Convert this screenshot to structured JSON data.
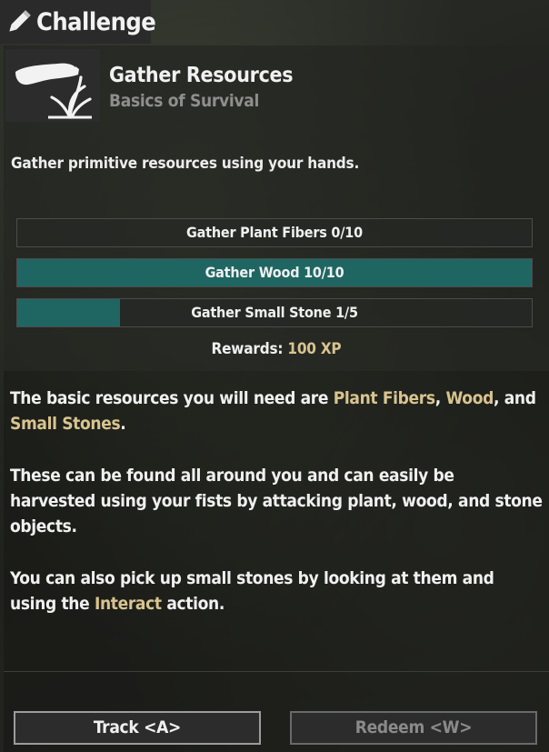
{
  "header": {
    "title": "Challenge",
    "icon": "pencil-icon"
  },
  "quest": {
    "icon": "gather-hand-icon",
    "title": "Gather Resources",
    "subtitle": "Basics of Survival",
    "description": "Gather primitive resources using your hands."
  },
  "objectives": [
    {
      "label": "Gather Plant Fibers 0/10",
      "progress": 0.0
    },
    {
      "label": "Gather Wood 10/10",
      "progress": 1.0
    },
    {
      "label": "Gather Small Stone 1/5",
      "progress": 0.2
    }
  ],
  "rewards": {
    "label": "Rewards:",
    "value": "100 XP"
  },
  "body": {
    "p1": {
      "t1": "The basic resources you will need are ",
      "h1": "Plant Fibers",
      "t2": ", ",
      "h2": "Wood",
      "t3": ", and ",
      "h3": "Small Stones",
      "t4": "."
    },
    "p2": "These can be found all around you and can easily be harvested using your fists by attacking plant, wood, and stone objects.",
    "p3": {
      "t1": "You can also pick up small stones by looking at them and using the ",
      "h1": "Interact",
      "t2": " action."
    }
  },
  "buttons": {
    "track": "Track <A>",
    "redeem": "Redeem <W>"
  },
  "colors": {
    "accent_text": "#d8c48f",
    "progress_fill": "#1f6663",
    "panel": "#2c2c2c"
  }
}
